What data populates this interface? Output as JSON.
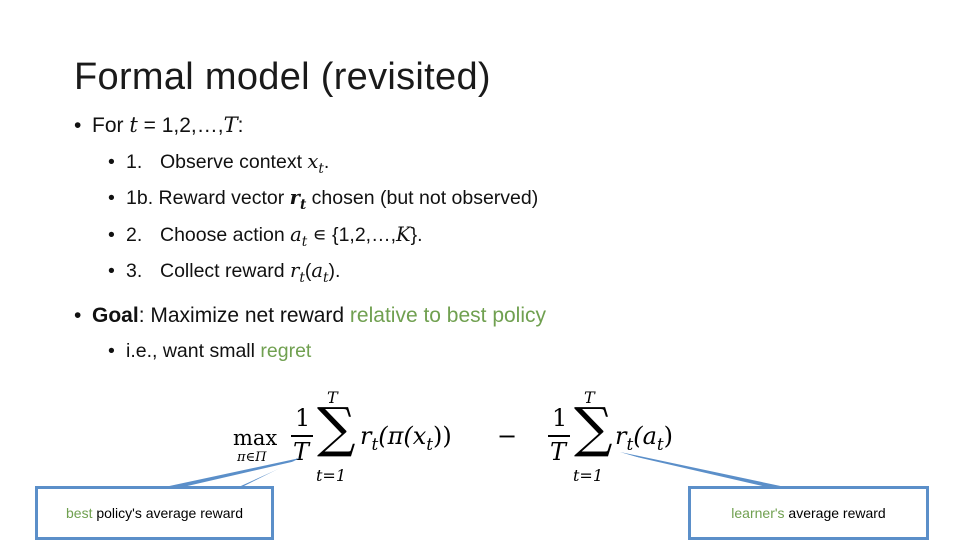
{
  "slide": {
    "title": "Formal model (revisited)",
    "loop_header": {
      "prefix": "For ",
      "var": "t",
      "suffix": " = 1,2,…,",
      "end_var": "T",
      "colon": ":"
    },
    "steps": [
      {
        "num": "1.",
        "text": "Observe context ",
        "math": "x",
        "sub": "t",
        "after": "."
      },
      {
        "num": "1b.",
        "text": "Reward vector ",
        "math": "r",
        "sub": "t",
        "after": " chosen (but not observed)"
      },
      {
        "num": "2.",
        "text": "Choose action ",
        "math": "a",
        "sub": "t",
        "after": " ∊ {1,2,…,",
        "after_math": "K",
        "after_end": "}."
      },
      {
        "num": "3.",
        "text": "Collect reward ",
        "math": "r",
        "sub": "t",
        "after": "(",
        "after_math": "a",
        "after_sub": "t",
        "after_end": ")."
      }
    ],
    "goal": {
      "label": "Goal",
      "colon": ": ",
      "text": "Maximize net reward ",
      "highlight": "relative to best policy"
    },
    "regret": {
      "text": "i.e., want small ",
      "highlight": "regret"
    },
    "formula": {
      "max": "max",
      "max_sub": "π∈Π",
      "one": "1",
      "T": "T",
      "sigma": "∑",
      "sum_top": "T",
      "sum_bottom": "t=1",
      "left_term": "r",
      "left_sub": "t",
      "left_arg": "(π(x",
      "left_arg_sub": "t",
      "left_arg_end": "))",
      "minus": "−",
      "right_term": "r",
      "right_sub": "t",
      "right_arg": "(a",
      "right_arg_sub": "t",
      "right_arg_end": ")"
    },
    "callouts": {
      "left": {
        "highlight": "best",
        "text": " policy's average reward"
      },
      "right": {
        "highlight": "learner's",
        "text": " average reward"
      }
    },
    "colors": {
      "accent_green": "#70a050",
      "callout_blue": "#5b8fc9"
    }
  }
}
